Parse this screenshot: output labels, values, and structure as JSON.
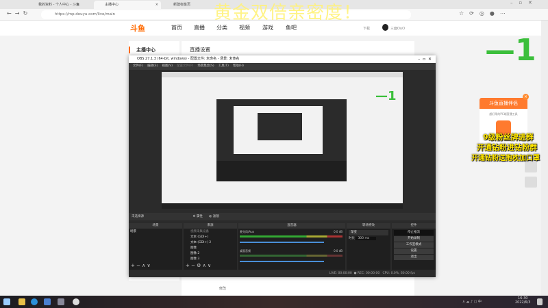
{
  "browser": {
    "tabs": [
      {
        "label": "我的资料 - 个人中心 - 斗鱼"
      },
      {
        "label": "主播中心"
      },
      {
        "label": "新建标签页"
      }
    ],
    "url": "https://mp.douyu.com/live/main"
  },
  "site": {
    "logo": "斗鱼",
    "nav": [
      "首页",
      "直播",
      "分类",
      "视频",
      "游戏",
      "鱼吧"
    ],
    "download": "下载",
    "user": "三面OuO",
    "sidebar_title": "主播中心",
    "page_title": "直播设置",
    "bottom_button": "修改"
  },
  "overlay": {
    "banner": "黄金双倍亲密度！",
    "counter": "—1"
  },
  "promo": {
    "title": "斗鱼直播伴侣",
    "subtitle": "超好用的PC端直播工具",
    "lines": [
      "9级粉丝牌进群",
      "开通钻粉进钻粉群",
      "开通钻粉送抱枕加口罩"
    ]
  },
  "obs": {
    "title": "OBS 27.1.3 (64-bit, windows) - 配置文件: 未命名 - 场景: 未命名",
    "menu": [
      "文件(F)",
      "编辑(E)",
      "视图(V)",
      "配置文件(P)",
      "场景集合(S)",
      "工具(T)",
      "帮助(H)"
    ],
    "no_source": "未选择源",
    "props": "属性",
    "filters": "滤镜",
    "docks": {
      "scenes": "场景",
      "sources": "来源",
      "mixer": "混音器",
      "transitions": "转场特效",
      "controls": "控件"
    },
    "scenes": [
      "场景"
    ],
    "sources": [
      "视频采集设备",
      "文本 (GDI+)",
      "文本 (GDI+) 2",
      "图像",
      "图像 2",
      "图像 3"
    ],
    "mixer": [
      {
        "name": "麦克风/Aux",
        "db": "0.0 dB"
      },
      {
        "name": "桌面音频",
        "db": "0.0 dB"
      }
    ],
    "transition": "渐变",
    "duration_label": "时长",
    "duration": "300 ms",
    "controls": [
      "停止推流",
      "开始录制",
      "工作室模式",
      "设置",
      "退出"
    ],
    "status": {
      "live": "LIVE: 00:00:00",
      "rec": "REC: 00:00:00",
      "cpu": "CPU: 0.0%, 60.00 fps"
    }
  },
  "taskbar": {
    "time": "16:30",
    "date": "2022/6/3"
  }
}
